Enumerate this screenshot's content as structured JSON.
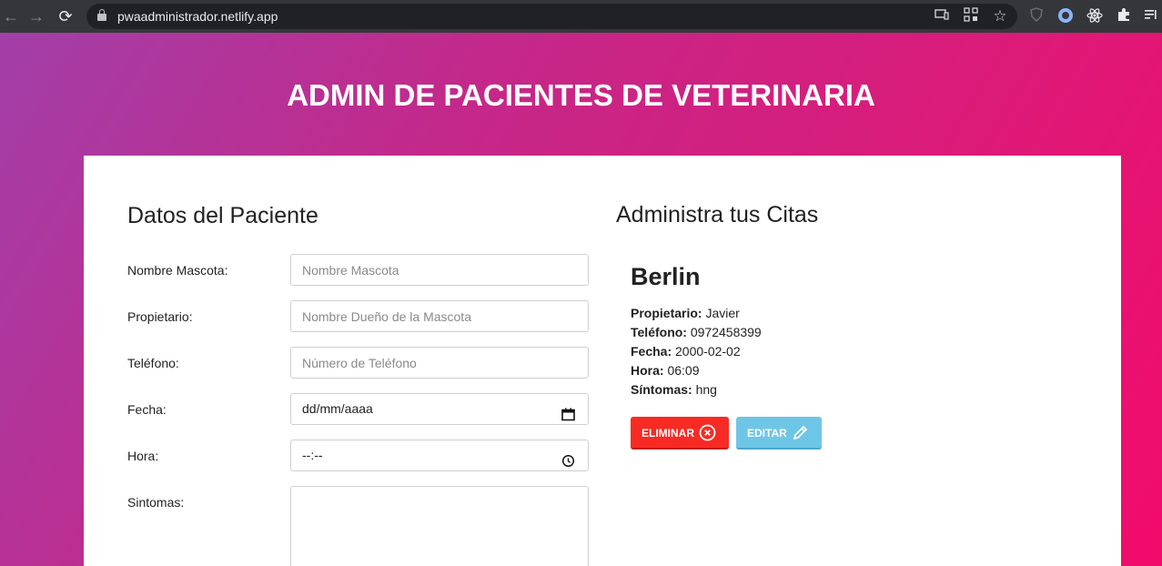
{
  "browser": {
    "url": "pwaadministrador.netlify.app",
    "back": "←",
    "forward": "→",
    "reload": "⟳",
    "icons": [
      "cast-icon",
      "qr-icon",
      "star-icon",
      "extension-shield-icon",
      "extension-circle-icon",
      "react-icon",
      "puzzle-icon",
      "reading-list-icon"
    ]
  },
  "page": {
    "title": "ADMIN DE PACIENTES DE VETERINARIA"
  },
  "form": {
    "heading": "Datos del Paciente",
    "fields": [
      {
        "label": "Nombre Mascota:",
        "placeholder": "Nombre Mascota"
      },
      {
        "label": "Propietario:",
        "placeholder": "Nombre Dueño de la Mascota"
      },
      {
        "label": "Teléfono:",
        "placeholder": "Número de Teléfono"
      },
      {
        "label": "Fecha:",
        "value": "dd/mm/aaaa"
      },
      {
        "label": "Hora:",
        "value": "--:--"
      },
      {
        "label": "Sintomas:",
        "value": ""
      }
    ]
  },
  "appointments": {
    "heading": "Administra tus Citas",
    "items": [
      {
        "name": "Berlin",
        "owner_label": "Propietario:",
        "owner": "Javier",
        "phone_label": "Teléfono:",
        "phone": "0972458399",
        "date_label": "Fecha:",
        "date": "2000-02-02",
        "time_label": "Hora:",
        "time": "06:09",
        "symptoms_label": "Síntomas:",
        "symptoms": "hng",
        "delete_label": "ELIMINAR",
        "edit_label": "EDITAR"
      }
    ]
  },
  "colors": {
    "gradient_start": "#a23fa8",
    "gradient_end": "#f20b6b",
    "delete_button": "#f72b24",
    "edit_button": "#6ec6e6"
  }
}
